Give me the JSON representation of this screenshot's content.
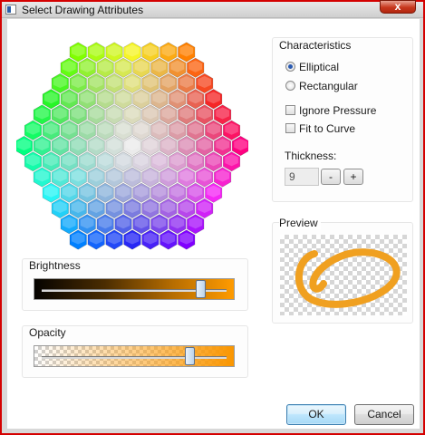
{
  "window": {
    "title": "Select Drawing Attributes",
    "close_glyph": "x"
  },
  "brightness": {
    "label": "Brightness",
    "value": 0.88
  },
  "opacity": {
    "label": "Opacity",
    "value": 0.82
  },
  "characteristics": {
    "label": "Characteristics",
    "tip_elliptical": "Elliptical",
    "tip_rectangular": "Rectangular",
    "selected_tip": "Elliptical",
    "ignore_pressure": "Ignore Pressure",
    "ignore_pressure_checked": false,
    "fit_to_curve": "Fit to Curve",
    "fit_to_curve_checked": false,
    "thickness_label": "Thickness:",
    "thickness_value": "9",
    "minus": "-",
    "plus": "+"
  },
  "preview": {
    "label": "Preview",
    "stroke_color": "#f0a020"
  },
  "buttons": {
    "ok": "OK",
    "cancel": "Cancel"
  },
  "colors": {
    "accent": "#ff9b00",
    "selection": "#2a5ab0",
    "window_border": "#d40000"
  }
}
